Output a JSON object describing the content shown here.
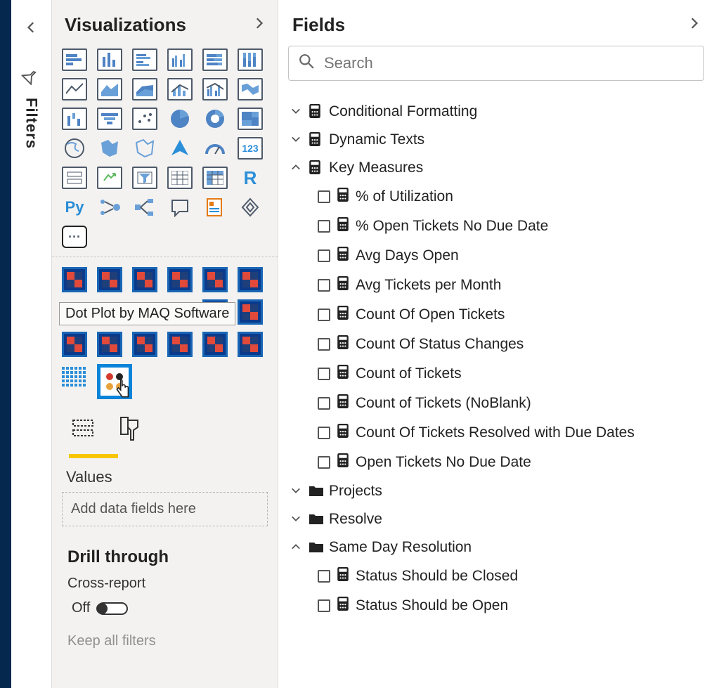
{
  "panes": {
    "filters_label": "Filters",
    "visualizations_title": "Visualizations",
    "fields_title": "Fields"
  },
  "tooltip": "Dot Plot by MAQ Software",
  "search": {
    "placeholder": "Search"
  },
  "values": {
    "label": "Values",
    "drop_placeholder": "Add data fields here"
  },
  "drill": {
    "title": "Drill through",
    "cross_report_label": "Cross-report",
    "toggle_state": "Off",
    "keep_filters_label": "Keep all filters"
  },
  "tables": [
    {
      "name": "Conditional Formatting",
      "expanded": false,
      "icon": "calc",
      "fields": []
    },
    {
      "name": "Dynamic Texts",
      "expanded": false,
      "icon": "calc",
      "fields": []
    },
    {
      "name": "Key Measures",
      "expanded": true,
      "icon": "calc",
      "fields": [
        "% of Utilization",
        "% Open Tickets No Due Date",
        "Avg Days Open",
        "Avg Tickets per Month",
        "Count Of Open Tickets",
        "Count Of Status Changes",
        "Count of Tickets",
        "Count of Tickets (NoBlank)",
        "Count Of Tickets Resolved with Due Dates",
        "Open Tickets No Due Date"
      ]
    },
    {
      "name": "Projects",
      "expanded": false,
      "icon": "folder",
      "fields": []
    },
    {
      "name": "Resolve",
      "expanded": false,
      "icon": "folder",
      "fields": []
    },
    {
      "name": "Same Day Resolution",
      "expanded": true,
      "icon": "folder",
      "fields": [
        "Status Should be Closed",
        "Status Should be Open"
      ]
    }
  ]
}
